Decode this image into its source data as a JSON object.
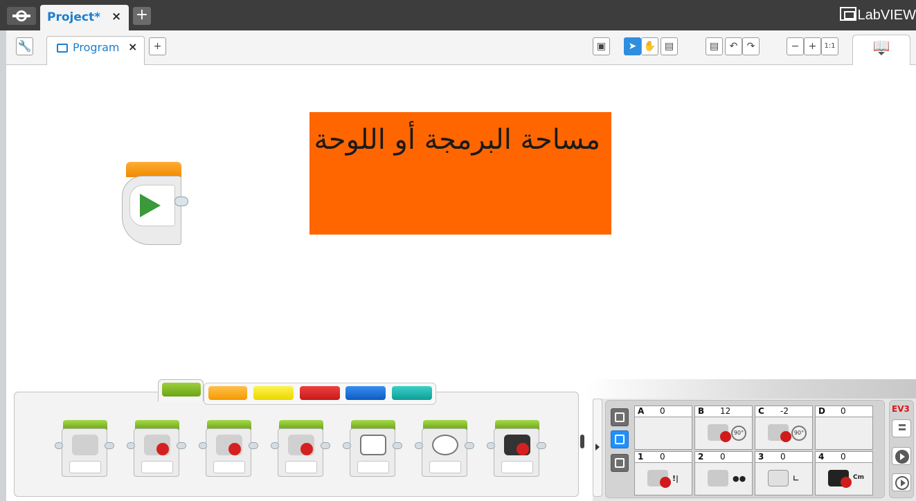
{
  "project_tabs": {
    "active_label": "Project*",
    "close_glyph": "×",
    "add_glyph": "+"
  },
  "brand": {
    "text": "LabVIEW"
  },
  "program_tabs": {
    "active_label": "Program",
    "close_glyph": "×",
    "add_glyph": "+"
  },
  "toolbar": {
    "zoom_reset_label": "1:1"
  },
  "canvas": {
    "annotation_text": "مساحة البرمجة أو اللوحة",
    "annotation_color": "#ff6600"
  },
  "start_block": {
    "icon": "play-icon",
    "color": "#f08a00"
  },
  "palette": {
    "tab_colors": [
      "#6aa517",
      "#f59a00",
      "#e8d800",
      "#c61a1a",
      "#0d5bc5",
      "#0f9d96"
    ],
    "blocks": [
      {
        "name": "medium-motor-block",
        "icon": "medium-motor-icon"
      },
      {
        "name": "large-motor-block",
        "icon": "large-motor-icon"
      },
      {
        "name": "move-steering-block",
        "icon": "steering-icon"
      },
      {
        "name": "move-tank-block",
        "icon": "tank-icon"
      },
      {
        "name": "display-block",
        "icon": "display-icon"
      },
      {
        "name": "sound-block",
        "icon": "sound-icon"
      },
      {
        "name": "brick-status-light-block",
        "icon": "status-light-icon"
      }
    ]
  },
  "hardware": {
    "ports": [
      {
        "id": "A",
        "value": "0"
      },
      {
        "id": "B",
        "value": "12"
      },
      {
        "id": "C",
        "value": "-2"
      },
      {
        "id": "D",
        "value": "0"
      },
      {
        "id": "1",
        "value": "0"
      },
      {
        "id": "2",
        "value": "0"
      },
      {
        "id": "3",
        "value": "0"
      },
      {
        "id": "4",
        "value": "0"
      }
    ],
    "rotation_unit_label": "90°",
    "ultrasonic_unit_label": "Cm",
    "brick_label": "EV3",
    "brick_color": "#d8161b"
  }
}
